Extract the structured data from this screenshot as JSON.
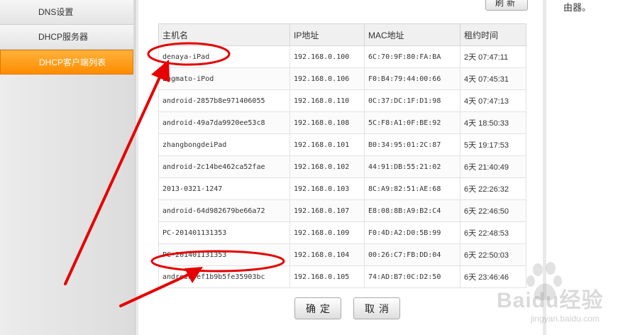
{
  "sidebar": {
    "items": [
      {
        "label": "DNS设置",
        "active": false
      },
      {
        "label": "DHCP服务器",
        "active": false
      },
      {
        "label": "DHCP客户端列表",
        "active": true
      }
    ]
  },
  "toolbar": {
    "refresh_label": "刷新"
  },
  "help": {
    "text": "由器。"
  },
  "table": {
    "headers": [
      "主机名",
      "IP地址",
      "MAC地址",
      "租约时间"
    ],
    "rows": [
      {
        "host": "denaya-iPad",
        "ip": "192.168.0.100",
        "mac": "6C:70:9F:80:FA:BA",
        "lease": "2天 07:47:11"
      },
      {
        "host": "zhgmato-iPod",
        "ip": "192.168.0.106",
        "mac": "F0:B4:79:44:00:66",
        "lease": "4天 07:45:31"
      },
      {
        "host": "android-2857b8e971406055",
        "ip": "192.168.0.110",
        "mac": "0C:37:DC:1F:D1:98",
        "lease": "4天 07:47:13"
      },
      {
        "host": "android-49a7da9920ee53c8",
        "ip": "192.168.0.108",
        "mac": "5C:F8:A1:0F:BE:92",
        "lease": "4天 18:50:33"
      },
      {
        "host": "zhangbongdeiPad",
        "ip": "192.168.0.101",
        "mac": "B0:34:95:01:2C:87",
        "lease": "5天 19:17:53"
      },
      {
        "host": "android-2c14be462ca52fae",
        "ip": "192.168.0.102",
        "mac": "44:91:DB:55:21:02",
        "lease": "6天 21:40:49"
      },
      {
        "host": "2013-0321-1247",
        "ip": "192.168.0.103",
        "mac": "8C:A9:82:51:AE:68",
        "lease": "6天 22:26:32"
      },
      {
        "host": "android-64d982679be66a72",
        "ip": "192.168.0.107",
        "mac": "E8:08:8B:A9:B2:C4",
        "lease": "6天 22:46:50"
      },
      {
        "host": "PC-201401131353",
        "ip": "192.168.0.109",
        "mac": "F0:4D:A2:D0:5B:99",
        "lease": "6天 22:48:53"
      },
      {
        "host": "PC-201401131353",
        "ip": "192.168.0.104",
        "mac": "00:26:C7:FB:DD:04",
        "lease": "6天 22:50:03"
      },
      {
        "host": "android-ef1b9b5fe35903bc",
        "ip": "192.168.0.105",
        "mac": "74:AD:B7:0C:D2:50",
        "lease": "6天 23:46:46"
      }
    ]
  },
  "buttons": {
    "ok_label": "确定",
    "cancel_label": "取消"
  },
  "annotations": {
    "color": "#e60000"
  },
  "watermark": {
    "brand": "Baidu经验",
    "url": "jingyan.baidu.com"
  }
}
